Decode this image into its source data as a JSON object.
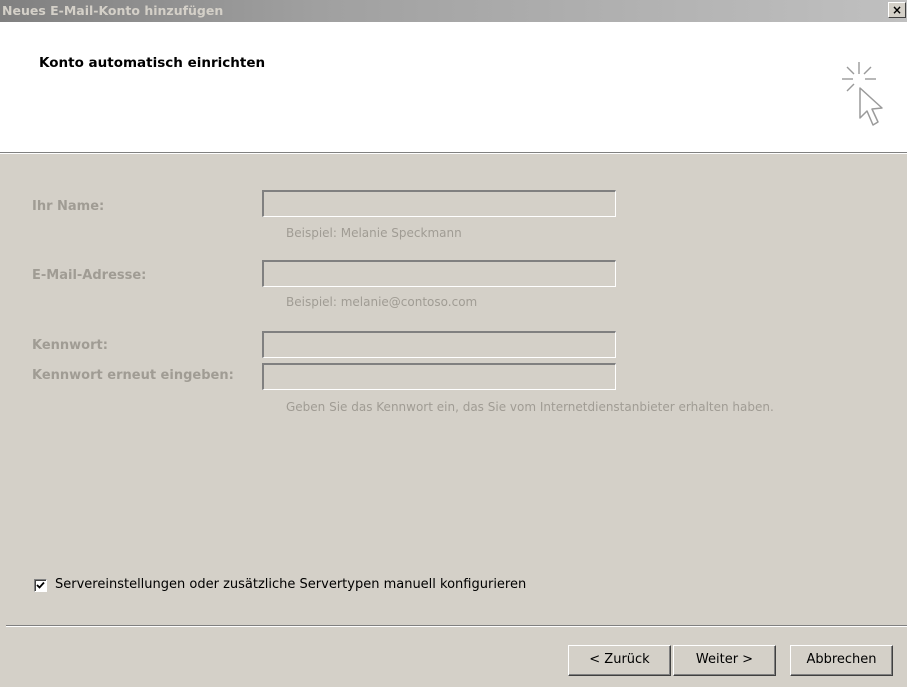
{
  "window": {
    "title": "Neues E-Mail-Konto hinzufügen",
    "close_label": "×"
  },
  "header": {
    "title": "Konto automatisch einrichten",
    "icon": "cursor-sparkle-icon"
  },
  "form": {
    "name": {
      "label": "Ihr Name:",
      "value": "",
      "hint": "Beispiel: Melanie Speckmann"
    },
    "email": {
      "label": "E-Mail-Adresse:",
      "value": "",
      "hint": "Beispiel: melanie@contoso.com"
    },
    "password": {
      "label": "Kennwort:",
      "value": ""
    },
    "password_confirm": {
      "label": "Kennwort erneut eingeben:",
      "value": "",
      "hint": "Geben Sie das Kennwort ein, das Sie vom Internetdienstanbieter erhalten haben."
    }
  },
  "manual_config": {
    "label": "Servereinstellungen oder zusätzliche Servertypen manuell konfigurieren",
    "checked": true
  },
  "buttons": {
    "back": "< Zurück",
    "next": "Weiter >",
    "cancel": "Abbrechen"
  },
  "colors": {
    "dialog_bg": "#d4d0c8",
    "disabled_text": "#a09c94",
    "header_bg": "#ffffff"
  }
}
